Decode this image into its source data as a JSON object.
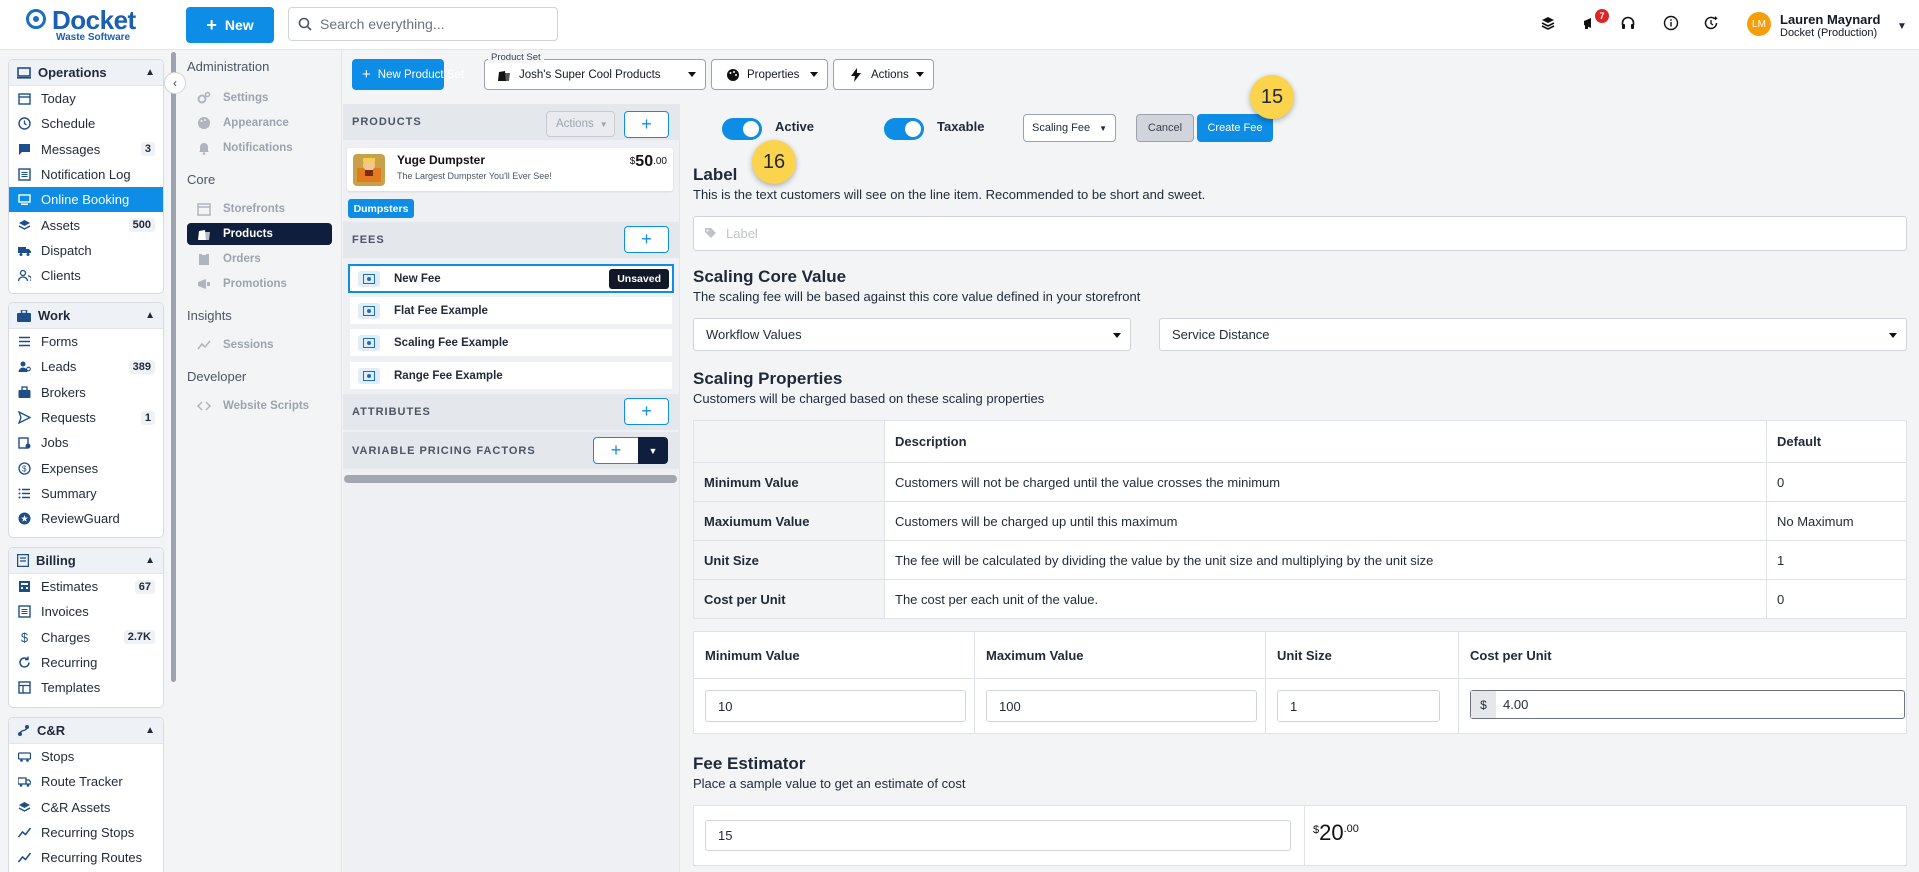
{
  "app": {
    "name": "Docket",
    "tagline": "Waste Software"
  },
  "topbar": {
    "new_label": "New",
    "search_placeholder": "Search everything...",
    "notif_count": "7",
    "user_initials": "LM",
    "user_name": "Lauren Maynard",
    "user_org": "Docket (Production)"
  },
  "nav": {
    "operations": {
      "title": "Operations",
      "items": [
        {
          "label": "Today"
        },
        {
          "label": "Schedule"
        },
        {
          "label": "Messages",
          "count": "3"
        },
        {
          "label": "Notification Log"
        },
        {
          "label": "Online Booking"
        },
        {
          "label": "Assets",
          "count": "500"
        },
        {
          "label": "Dispatch"
        },
        {
          "label": "Clients"
        }
      ]
    },
    "work": {
      "title": "Work",
      "items": [
        {
          "label": "Forms"
        },
        {
          "label": "Leads",
          "count": "389"
        },
        {
          "label": "Brokers"
        },
        {
          "label": "Requests",
          "count": "1"
        },
        {
          "label": "Jobs"
        },
        {
          "label": "Expenses"
        },
        {
          "label": "Summary"
        },
        {
          "label": "ReviewGuard"
        }
      ]
    },
    "billing": {
      "title": "Billing",
      "items": [
        {
          "label": "Estimates",
          "count": "67"
        },
        {
          "label": "Invoices"
        },
        {
          "label": "Charges",
          "count": "2.7K"
        },
        {
          "label": "Recurring"
        },
        {
          "label": "Templates"
        }
      ]
    },
    "cr": {
      "title": "C&R",
      "items": [
        {
          "label": "Stops"
        },
        {
          "label": "Route Tracker"
        },
        {
          "label": "C&R Assets"
        },
        {
          "label": "Recurring Stops"
        },
        {
          "label": "Recurring Routes"
        }
      ]
    }
  },
  "subnav": {
    "administration": "Administration",
    "settings": "Settings",
    "appearance": "Appearance",
    "notifications": "Notifications",
    "core": "Core",
    "storefronts": "Storefronts",
    "products": "Products",
    "orders": "Orders",
    "promotions": "Promotions",
    "insights": "Insights",
    "sessions": "Sessions",
    "developer": "Developer",
    "website_scripts": "Website Scripts"
  },
  "toolbar": {
    "new_product_set": "New Product Set",
    "product_set_label": "Product Set",
    "product_set_value": "Josh's Super Cool Products",
    "properties": "Properties",
    "actions": "Actions"
  },
  "products_panel": {
    "products_header": "PRODUCTS",
    "actions_label": "Actions",
    "product": {
      "name": "Yuge Dumpster",
      "desc": "The Largest Dumpster You'll Ever See!",
      "price_symbol": "$",
      "price_main": "50",
      "price_cents": ".00"
    },
    "category_tag": "Dumpsters",
    "fees_header": "FEES",
    "fees": [
      {
        "label": "New Fee",
        "status": "Unsaved"
      },
      {
        "label": "Flat Fee Example"
      },
      {
        "label": "Scaling Fee Example"
      },
      {
        "label": "Range Fee Example"
      }
    ],
    "attributes_header": "ATTRIBUTES",
    "vpf_header": "VARIABLE PRICING FACTORS"
  },
  "editor": {
    "active_label": "Active",
    "active_on": true,
    "taxable_label": "Taxable",
    "taxable_on": true,
    "fee_type": "Scaling Fee",
    "cancel_label": "Cancel",
    "create_label": "Create Fee",
    "label_title": "Label",
    "label_help": "This is the text customers will see on the line item. Recommended to be short and sweet.",
    "label_placeholder": "Label",
    "core_title": "Scaling Core Value",
    "core_help": "The scaling fee will be based against this core value defined in your storefront",
    "core_select_1": "Workflow Values",
    "core_select_2": "Service Distance",
    "props_title": "Scaling Properties",
    "props_help": "Customers will be charged based on these scaling properties",
    "props_table": {
      "headers": [
        "",
        "Description",
        "Default"
      ],
      "rows": [
        [
          "Minimum Value",
          "Customers will not be charged until the value crosses the minimum",
          "0"
        ],
        [
          "Maxiumum Value",
          "Customers will be charged up until this maximum",
          "No Maximum"
        ],
        [
          "Unit Size",
          "The fee will be calculated by dividing the value by the unit size and multiplying by the unit size",
          "1"
        ],
        [
          "Cost per Unit",
          "The cost per each unit of the value.",
          "0"
        ]
      ]
    },
    "inputs": {
      "min_label": "Minimum Value",
      "min_value": "10",
      "max_label": "Maximum Value",
      "max_value": "100",
      "unit_label": "Unit Size",
      "unit_value": "1",
      "cost_label": "Cost per Unit",
      "cost_prefix": "$",
      "cost_value": "4.00"
    },
    "estimator_title": "Fee Estimator",
    "estimator_help": "Place a sample value to get an estimate of cost",
    "estimator_value": "15",
    "estimate_symbol": "$",
    "estimate_main": "20",
    "estimate_cents": ".00"
  },
  "callouts": {
    "a": "15",
    "b": "16"
  },
  "colors": {
    "primary": "#0d8de6",
    "nav_active": "#0f1e3d",
    "callout": "#fcd34d"
  }
}
